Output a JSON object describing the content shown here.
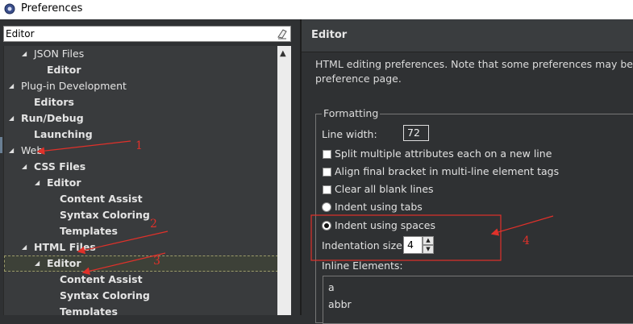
{
  "window": {
    "title": "Preferences"
  },
  "filter": {
    "value": "Editor"
  },
  "tree": [
    {
      "label": "JSON Files",
      "twisty": true,
      "bold": false
    },
    {
      "label": "Editor",
      "twisty": false,
      "bold": true
    },
    {
      "label": "Plug-in Development",
      "twisty": true,
      "bold": false
    },
    {
      "label": "Editors",
      "twisty": false,
      "bold": true
    },
    {
      "label": "Run/Debug",
      "twisty": true,
      "bold": true
    },
    {
      "label": "Launching",
      "twisty": false,
      "bold": true
    },
    {
      "label": "Web",
      "twisty": true,
      "bold": false
    },
    {
      "label": "CSS Files",
      "twisty": true,
      "bold": true
    },
    {
      "label": "Editor",
      "twisty": true,
      "bold": true
    },
    {
      "label": "Content Assist",
      "twisty": false,
      "bold": true
    },
    {
      "label": "Syntax Coloring",
      "twisty": false,
      "bold": true
    },
    {
      "label": "Templates",
      "twisty": false,
      "bold": true
    },
    {
      "label": "HTML Files",
      "twisty": true,
      "bold": true
    },
    {
      "label": "Editor",
      "twisty": true,
      "bold": true,
      "selected": true
    },
    {
      "label": "Content Assist",
      "twisty": false,
      "bold": true
    },
    {
      "label": "Syntax Coloring",
      "twisty": false,
      "bold": true
    },
    {
      "label": "Templates",
      "twisty": false,
      "bold": true
    }
  ],
  "page": {
    "title": "Editor",
    "description_line1": "HTML editing preferences.  Note that some preferences may be set",
    "description_line2": "preference page."
  },
  "formatting": {
    "group_title": "Formatting",
    "line_width_label": "Line width:",
    "line_width_value": "72",
    "split_attributes": {
      "label": "Split multiple attributes each on a new line",
      "checked": false
    },
    "align_bracket": {
      "label": "Align final bracket in multi-line element tags",
      "checked": false
    },
    "clear_blank": {
      "label": "Clear all blank lines",
      "checked": false
    },
    "indent_tabs": {
      "label": "Indent using tabs",
      "selected": false
    },
    "indent_spaces": {
      "label": "Indent using spaces",
      "selected": true
    },
    "indentation_size_label": "Indentation size:",
    "indentation_size_value": "4",
    "inline_elements_label": "Inline Elements:",
    "inline_elements": [
      "a",
      "abbr"
    ]
  },
  "annotations": {
    "labels": [
      "1",
      "2",
      "3",
      "4"
    ],
    "color": "#e0312a"
  },
  "colors": {
    "pane_bg": "#2f3133",
    "tree_bg": "#393b3d",
    "annotation": "#e0312a"
  }
}
